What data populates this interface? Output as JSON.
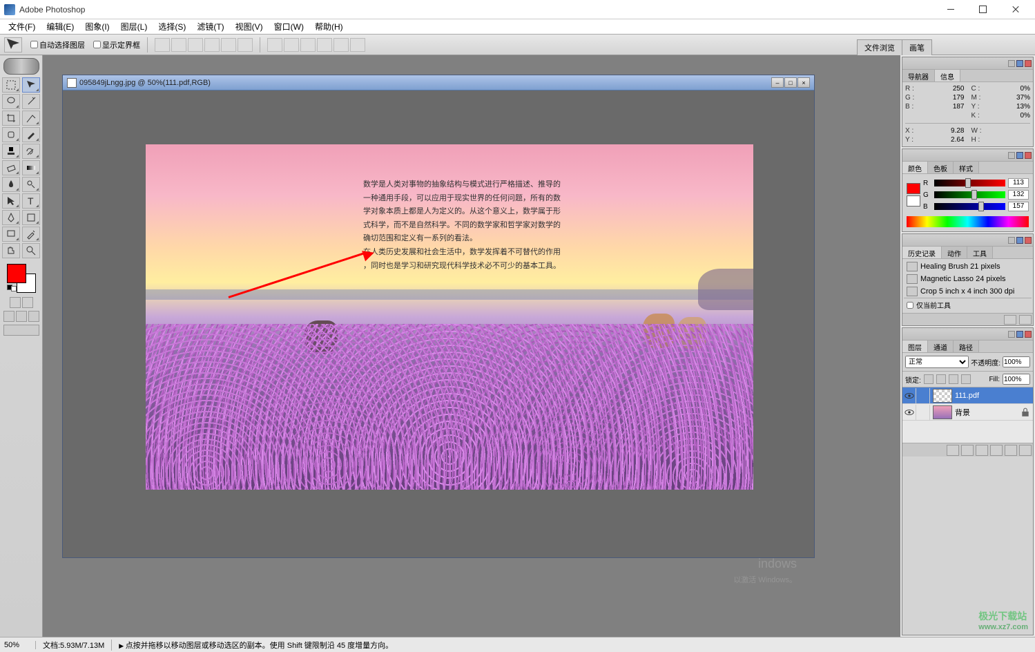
{
  "app": {
    "title": "Adobe Photoshop"
  },
  "menu": [
    "文件(F)",
    "编辑(E)",
    "图象(I)",
    "图层(L)",
    "选择(S)",
    "滤镜(T)",
    "视图(V)",
    "窗口(W)",
    "帮助(H)"
  ],
  "options": {
    "check1": "自动选择图层",
    "check2": "显示定界框",
    "tabs": [
      "文件浏览",
      "画笔"
    ]
  },
  "document": {
    "title": "095849jLngg.jpg @ 50%(111.pdf,RGB)",
    "text_lines": [
      "数学是人类对事物的抽象结构与模式进行严格描述、推导的",
      "一种通用手段，可以应用于现实世界的任何问题，所有的数",
      "学对象本质上都是人为定义的。从这个意义上，数学属于形",
      "式科学，而不是自然科学。不同的数学家和哲学家对数学的",
      "确切范围和定义有一系列的看法。",
      "在人类历史发展和社会生活中，数学发挥着不可替代的作用",
      "，同时也是学习和研究现代科学技术必不可少的基本工具。"
    ]
  },
  "navigator": {
    "tabs": [
      "导航器",
      "信息"
    ],
    "rgb": {
      "R": "250",
      "G": "179",
      "B": "187"
    },
    "cmyk": {
      "C": "0%",
      "M": "37%",
      "Y": "13%",
      "K": "0%"
    },
    "xy": {
      "X": "9.28",
      "Y": "2.64"
    },
    "wh": {
      "W": "",
      "H": ""
    }
  },
  "color": {
    "tabs": [
      "颜色",
      "色板",
      "样式"
    ],
    "R": "113",
    "G": "132",
    "B": "157"
  },
  "history": {
    "tabs": [
      "历史记录",
      "动作",
      "工具"
    ],
    "items": [
      "Healing Brush 21 pixels",
      "Magnetic Lasso 24 pixels",
      "Crop 5 inch x 4 inch 300 dpi"
    ],
    "checkbox": "仅当前工具"
  },
  "layers": {
    "tabs": [
      "图层",
      "通道",
      "路径"
    ],
    "blend_mode": "正常",
    "opacity_label": "不透明度:",
    "opacity": "100%",
    "lock_label": "锁定:",
    "fill_label": "Fill:",
    "fill": "100%",
    "items": [
      {
        "name": "111.pdf",
        "selected": true,
        "locked": false
      },
      {
        "name": "背景",
        "selected": false,
        "locked": true
      }
    ]
  },
  "status": {
    "zoom": "50%",
    "doc": "文档:5.93M/7.13M",
    "hint": "点按并拖移以移动图层或移动选区的副本。使用 Shift 键限制沿 45 度增量方向。"
  },
  "watermark": {
    "brand": "极光下载站",
    "url": "www.xz7.com"
  },
  "activate": {
    "title": "indows",
    "sub": "以激活 Windows。"
  }
}
